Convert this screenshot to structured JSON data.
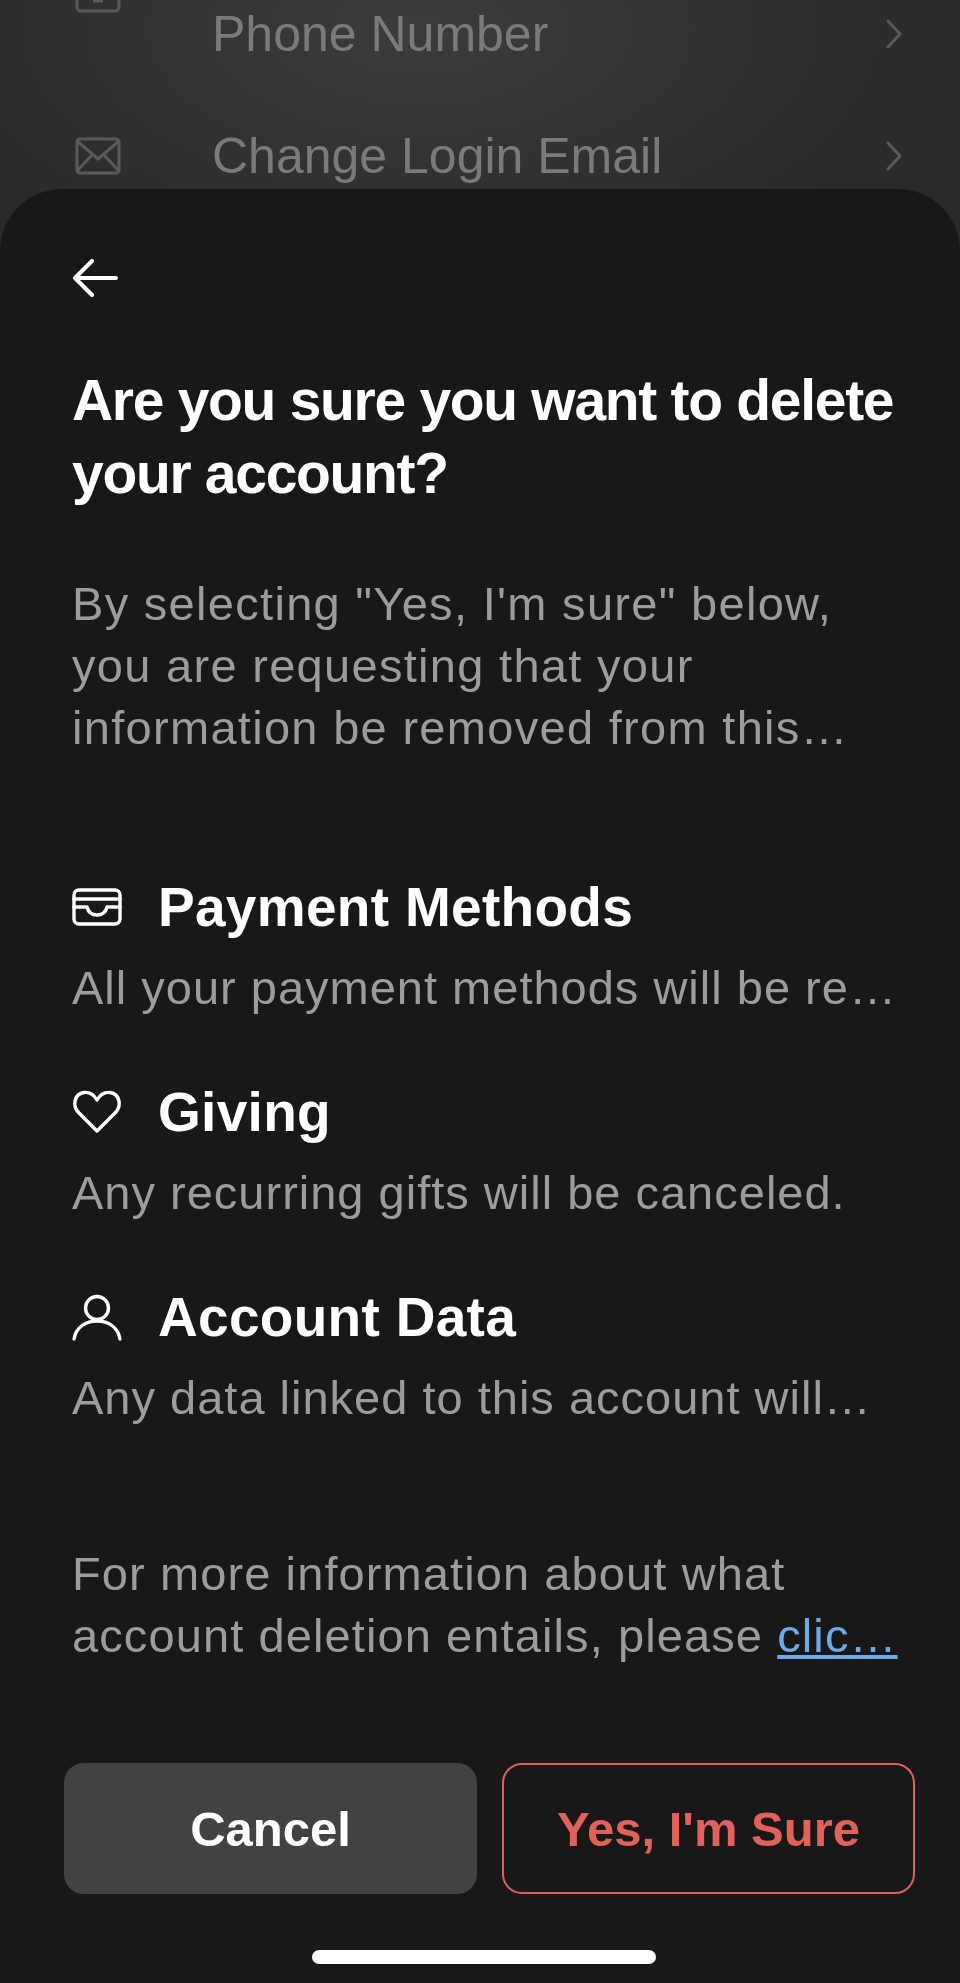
{
  "background_list": {
    "items": [
      {
        "kind": "phone",
        "label": "Phone Number"
      },
      {
        "kind": "email",
        "label": "Change Login Email"
      }
    ]
  },
  "sheet": {
    "title": "Are you sure you want to delete your account?",
    "description": "By selecting \"Yes, I'm sure\" below, you are requesting that your information be removed from this…",
    "sections": [
      {
        "kind": "payments",
        "title": "Payment Methods",
        "description": "All your payment methods will be re…"
      },
      {
        "kind": "giving",
        "title": "Giving",
        "description": "Any recurring gifts will be canceled."
      },
      {
        "kind": "account",
        "title": "Account Data",
        "description": "Any data linked to this account will…"
      }
    ],
    "footer": {
      "text": "For more information about what account deletion entails, please ",
      "link": "clic…"
    },
    "buttons": [
      {
        "kind": "secondary",
        "label": "Cancel"
      },
      {
        "kind": "destructive",
        "label": "Yes, I'm Sure"
      }
    ]
  }
}
